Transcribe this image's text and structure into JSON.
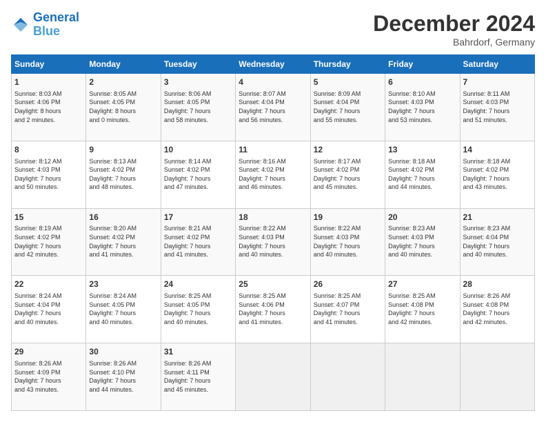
{
  "header": {
    "logo_line1": "General",
    "logo_line2": "Blue",
    "month": "December 2024",
    "location": "Bahrdorf, Germany"
  },
  "days_of_week": [
    "Sunday",
    "Monday",
    "Tuesday",
    "Wednesday",
    "Thursday",
    "Friday",
    "Saturday"
  ],
  "weeks": [
    [
      {
        "day": 1,
        "info": "Sunrise: 8:03 AM\nSunset: 4:06 PM\nDaylight: 8 hours\nand 2 minutes."
      },
      {
        "day": 2,
        "info": "Sunrise: 8:05 AM\nSunset: 4:05 PM\nDaylight: 8 hours\nand 0 minutes."
      },
      {
        "day": 3,
        "info": "Sunrise: 8:06 AM\nSunset: 4:05 PM\nDaylight: 7 hours\nand 58 minutes."
      },
      {
        "day": 4,
        "info": "Sunrise: 8:07 AM\nSunset: 4:04 PM\nDaylight: 7 hours\nand 56 minutes."
      },
      {
        "day": 5,
        "info": "Sunrise: 8:09 AM\nSunset: 4:04 PM\nDaylight: 7 hours\nand 55 minutes."
      },
      {
        "day": 6,
        "info": "Sunrise: 8:10 AM\nSunset: 4:03 PM\nDaylight: 7 hours\nand 53 minutes."
      },
      {
        "day": 7,
        "info": "Sunrise: 8:11 AM\nSunset: 4:03 PM\nDaylight: 7 hours\nand 51 minutes."
      }
    ],
    [
      {
        "day": 8,
        "info": "Sunrise: 8:12 AM\nSunset: 4:03 PM\nDaylight: 7 hours\nand 50 minutes."
      },
      {
        "day": 9,
        "info": "Sunrise: 8:13 AM\nSunset: 4:02 PM\nDaylight: 7 hours\nand 48 minutes."
      },
      {
        "day": 10,
        "info": "Sunrise: 8:14 AM\nSunset: 4:02 PM\nDaylight: 7 hours\nand 47 minutes."
      },
      {
        "day": 11,
        "info": "Sunrise: 8:16 AM\nSunset: 4:02 PM\nDaylight: 7 hours\nand 46 minutes."
      },
      {
        "day": 12,
        "info": "Sunrise: 8:17 AM\nSunset: 4:02 PM\nDaylight: 7 hours\nand 45 minutes."
      },
      {
        "day": 13,
        "info": "Sunrise: 8:18 AM\nSunset: 4:02 PM\nDaylight: 7 hours\nand 44 minutes."
      },
      {
        "day": 14,
        "info": "Sunrise: 8:18 AM\nSunset: 4:02 PM\nDaylight: 7 hours\nand 43 minutes."
      }
    ],
    [
      {
        "day": 15,
        "info": "Sunrise: 8:19 AM\nSunset: 4:02 PM\nDaylight: 7 hours\nand 42 minutes."
      },
      {
        "day": 16,
        "info": "Sunrise: 8:20 AM\nSunset: 4:02 PM\nDaylight: 7 hours\nand 41 minutes."
      },
      {
        "day": 17,
        "info": "Sunrise: 8:21 AM\nSunset: 4:02 PM\nDaylight: 7 hours\nand 41 minutes."
      },
      {
        "day": 18,
        "info": "Sunrise: 8:22 AM\nSunset: 4:03 PM\nDaylight: 7 hours\nand 40 minutes."
      },
      {
        "day": 19,
        "info": "Sunrise: 8:22 AM\nSunset: 4:03 PM\nDaylight: 7 hours\nand 40 minutes."
      },
      {
        "day": 20,
        "info": "Sunrise: 8:23 AM\nSunset: 4:03 PM\nDaylight: 7 hours\nand 40 minutes."
      },
      {
        "day": 21,
        "info": "Sunrise: 8:23 AM\nSunset: 4:04 PM\nDaylight: 7 hours\nand 40 minutes."
      }
    ],
    [
      {
        "day": 22,
        "info": "Sunrise: 8:24 AM\nSunset: 4:04 PM\nDaylight: 7 hours\nand 40 minutes."
      },
      {
        "day": 23,
        "info": "Sunrise: 8:24 AM\nSunset: 4:05 PM\nDaylight: 7 hours\nand 40 minutes."
      },
      {
        "day": 24,
        "info": "Sunrise: 8:25 AM\nSunset: 4:05 PM\nDaylight: 7 hours\nand 40 minutes."
      },
      {
        "day": 25,
        "info": "Sunrise: 8:25 AM\nSunset: 4:06 PM\nDaylight: 7 hours\nand 41 minutes."
      },
      {
        "day": 26,
        "info": "Sunrise: 8:25 AM\nSunset: 4:07 PM\nDaylight: 7 hours\nand 41 minutes."
      },
      {
        "day": 27,
        "info": "Sunrise: 8:25 AM\nSunset: 4:08 PM\nDaylight: 7 hours\nand 42 minutes."
      },
      {
        "day": 28,
        "info": "Sunrise: 8:26 AM\nSunset: 4:08 PM\nDaylight: 7 hours\nand 42 minutes."
      }
    ],
    [
      {
        "day": 29,
        "info": "Sunrise: 8:26 AM\nSunset: 4:09 PM\nDaylight: 7 hours\nand 43 minutes."
      },
      {
        "day": 30,
        "info": "Sunrise: 8:26 AM\nSunset: 4:10 PM\nDaylight: 7 hours\nand 44 minutes."
      },
      {
        "day": 31,
        "info": "Sunrise: 8:26 AM\nSunset: 4:11 PM\nDaylight: 7 hours\nand 45 minutes."
      },
      null,
      null,
      null,
      null
    ]
  ]
}
